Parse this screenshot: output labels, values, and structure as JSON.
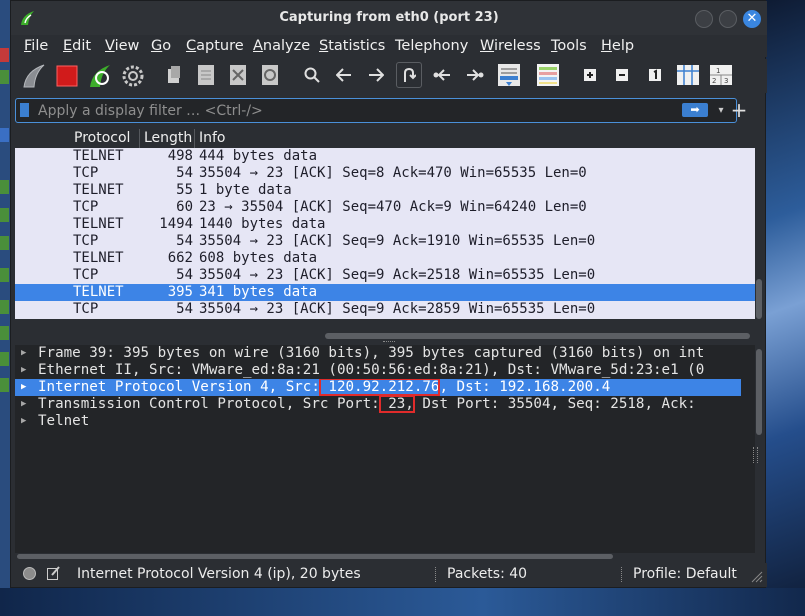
{
  "window": {
    "title": "Capturing from eth0 (port 23)"
  },
  "menubar": {
    "items": [
      {
        "mnemonic": "F",
        "rest": "ile"
      },
      {
        "mnemonic": "E",
        "rest": "dit"
      },
      {
        "mnemonic": "V",
        "rest": "iew"
      },
      {
        "mnemonic": "G",
        "rest": "o"
      },
      {
        "mnemonic": "C",
        "rest": "apture"
      },
      {
        "mnemonic": "A",
        "rest": "nalyze"
      },
      {
        "mnemonic": "S",
        "rest": "tatistics"
      },
      {
        "mnemonic": "",
        "rest": "Telephony"
      },
      {
        "mnemonic": "W",
        "rest": "ireless"
      },
      {
        "mnemonic": "T",
        "rest": "ools"
      },
      {
        "mnemonic": "H",
        "rest": "elp"
      }
    ]
  },
  "toolbar": {
    "icons": [
      "shark-fin-start-icon",
      "stop-capture-icon",
      "restart-capture-icon",
      "capture-options-gear-icon",
      "open-file-icon",
      "save-file-icon",
      "close-file-icon",
      "reload-file-icon",
      "find-packet-icon",
      "go-back-icon",
      "go-forward-icon",
      "go-to-packet-icon",
      "first-packet-icon",
      "last-packet-icon",
      "auto-scroll-icon",
      "colorize-icon",
      "zoom-in-icon",
      "zoom-out-icon",
      "normal-size-icon",
      "resize-columns-icon",
      "layout-icon"
    ]
  },
  "filter": {
    "placeholder": "Apply a display filter … <Ctrl-/>",
    "value": ""
  },
  "packet_list": {
    "columns": [
      "Protocol",
      "Length",
      "Info"
    ],
    "rows": [
      {
        "protocol": "TELNET",
        "length": "498",
        "info": "444 bytes data",
        "selected": false
      },
      {
        "protocol": "TCP",
        "length": "54",
        "info": "35504 → 23 [ACK] Seq=8 Ack=470 Win=65535 Len=0",
        "selected": false
      },
      {
        "protocol": "TELNET",
        "length": "55",
        "info": "1 byte data",
        "selected": false
      },
      {
        "protocol": "TCP",
        "length": "60",
        "info": "23 → 35504 [ACK] Seq=470 Ack=9 Win=64240 Len=0",
        "selected": false
      },
      {
        "protocol": "TELNET",
        "length": "1494",
        "info": "1440 bytes data",
        "selected": false
      },
      {
        "protocol": "TCP",
        "length": "54",
        "info": "35504 → 23 [ACK] Seq=9 Ack=1910 Win=65535 Len=0",
        "selected": false
      },
      {
        "protocol": "TELNET",
        "length": "662",
        "info": "608 bytes data",
        "selected": false
      },
      {
        "protocol": "TCP",
        "length": "54",
        "info": "35504 → 23 [ACK] Seq=9 Ack=2518 Win=65535 Len=0",
        "selected": false
      },
      {
        "protocol": "TELNET",
        "length": "395",
        "info": "341 bytes data",
        "selected": true
      },
      {
        "protocol": "TCP",
        "length": "54",
        "info": "35504 → 23 [ACK] Seq=9 Ack=2859 Win=65535 Len=0",
        "selected": false
      }
    ]
  },
  "details": {
    "frame": "Frame 39: 395 bytes on wire (3160 bits), 395 bytes captured (3160 bits) on int",
    "ethernet": "Ethernet II, Src: VMware_ed:8a:21 (00:50:56:ed:8a:21), Dst: VMware_5d:23:e1 (0",
    "ip": {
      "prefix": "Internet Protocol Version 4, Src:",
      "src": " 120.92.212.76",
      "suffix": ", Dst: 192.168.200.4"
    },
    "tcp": {
      "prefix": "Transmission Control Protocol, Src Port:",
      "port": " 23,",
      "suffix": " Dst Port: 35504, Seq: 2518, Ack:"
    },
    "telnet": "Telnet"
  },
  "statusbar": {
    "field": "Internet Protocol Version 4 (ip), 20 bytes",
    "packets": "Packets: 40",
    "profile": "Profile: Default"
  },
  "colors": {
    "selection": "#3d84e6",
    "packet_row_bg": "#e6e6f5",
    "highlight_box": "#e02b2b",
    "stop_red": "#d11b1b",
    "accent_blue": "#3a86e0"
  }
}
